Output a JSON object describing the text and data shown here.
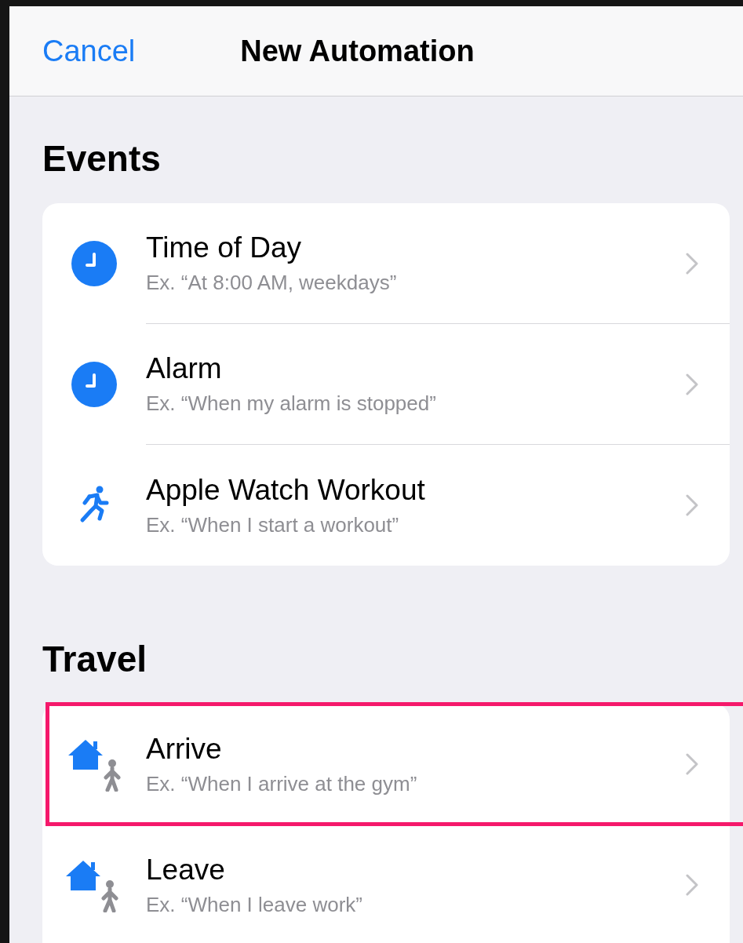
{
  "nav_bar": {
    "cancel": "Cancel",
    "title": "New Automation"
  },
  "sections": [
    {
      "title": "Events",
      "items": [
        {
          "kind": "clock",
          "title": "Time of Day",
          "example": "Ex. “At 8:00 AM, weekdays”",
          "highlighted": false
        },
        {
          "kind": "clock",
          "title": "Alarm",
          "example": "Ex. “When my alarm is stopped”",
          "highlighted": false
        },
        {
          "kind": "runner",
          "title": "Apple Watch Workout",
          "example": "Ex. “When I start a workout”",
          "highlighted": false
        }
      ]
    },
    {
      "title": "Travel",
      "items": [
        {
          "kind": "home",
          "title": "Arrive",
          "example": "Ex. “When I arrive at the gym”",
          "highlighted": true
        },
        {
          "kind": "home",
          "title": "Leave",
          "example": "Ex. “When I leave work”",
          "highlighted": false
        }
      ]
    }
  ]
}
